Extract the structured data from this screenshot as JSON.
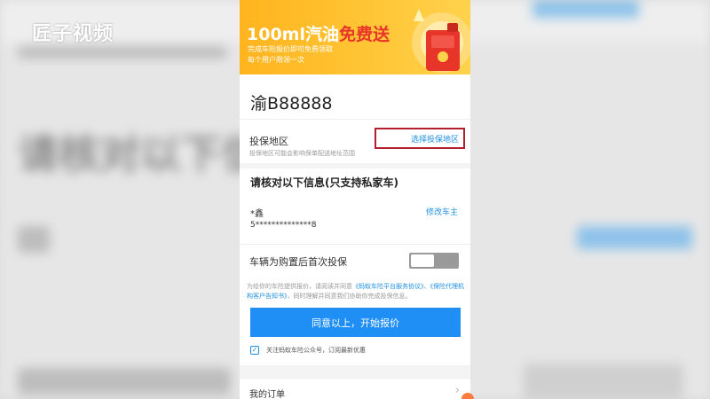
{
  "watermark": "匠子视频",
  "promo": {
    "title_main": "100ml汽油",
    "title_highlight": "免费送",
    "line1": "完成车险报价即可免费领取",
    "line2": "每个用户限领一次"
  },
  "plate": "渝B88888",
  "region": {
    "label": "投保地区",
    "hint": "投保地区可能会影响保单配送地址范围",
    "select_label": "选择投保地区"
  },
  "verify_title": "请核对以下信息(只支持私家车)",
  "owner": {
    "label": "*鑫",
    "id": "5**************8",
    "edit_label": "修改车主"
  },
  "first_insure": {
    "label": "车辆为购置后首次投保",
    "enabled": false
  },
  "agreement": {
    "text_before": "为给你的车险提供报价，请阅读并同意",
    "link1": "《蚂蚁车险平台服务协议》",
    "text_mid": "、",
    "link2": "《保险代理机构客户告知书》",
    "text_after": "，同时理解并同意我们协助你完成投保信息。"
  },
  "submit_label": "同意以上，开始报价",
  "follow": {
    "checked": true,
    "check_mark": "✓",
    "text": "关注蚂蚁车险公众号，订阅最新优惠"
  },
  "orders": {
    "label": "我的订单",
    "chevron": "›"
  },
  "colors": {
    "accent": "#1f8ff5",
    "link": "#1e8fe0",
    "promo_bg": "#ffb41e",
    "promo_highlight": "#e8352a",
    "highlight_box": "#b01f2a"
  }
}
